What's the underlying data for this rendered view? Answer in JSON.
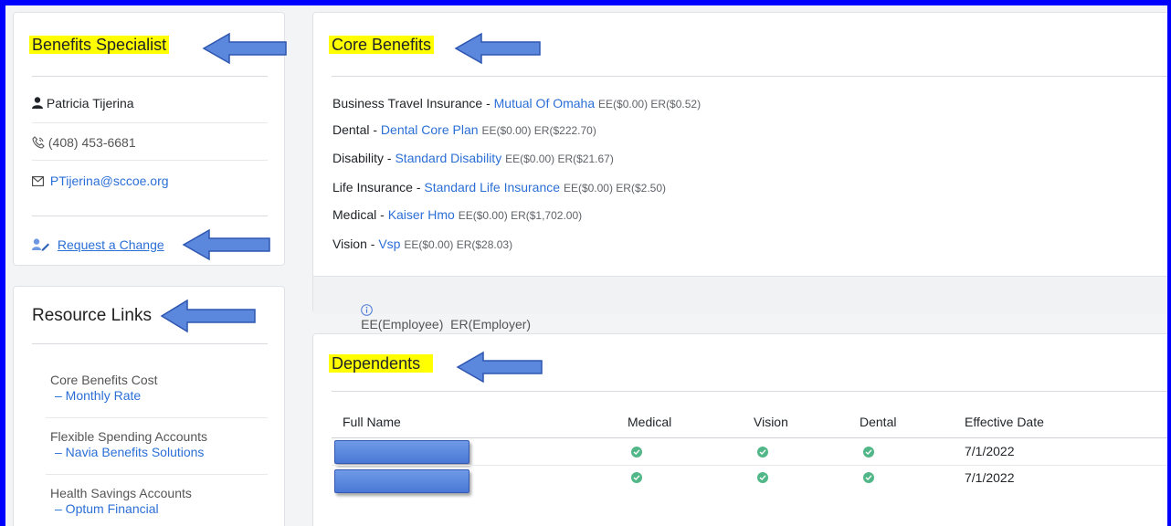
{
  "specialist": {
    "title": "Benefits Specialist",
    "name": "Patricia Tijerina",
    "phone": "(408) 453-6681",
    "email": "PTijerina@sccoe.org",
    "request_link": "Request a Change"
  },
  "resources": {
    "title": "Resource Links",
    "items": [
      {
        "label": "Core Benefits Cost",
        "link": "– Monthly Rate"
      },
      {
        "label": "Flexible Spending Accounts",
        "link": "– Navia Benefits Solutions"
      },
      {
        "label": "Health Savings Accounts",
        "link": "– Optum Financial"
      }
    ]
  },
  "core": {
    "title": "Core Benefits",
    "items": [
      {
        "category": "Business Travel Insurance -",
        "plan": "Mutual Of Omaha",
        "cost": "EE($0.00) ER($0.52)"
      },
      {
        "category": "Dental -",
        "plan": "Dental Core Plan",
        "cost": "EE($0.00) ER($222.70)"
      },
      {
        "category": "Disability -",
        "plan": "Standard Disability",
        "cost": "EE($0.00) ER($21.67)"
      },
      {
        "category": "Life Insurance -",
        "plan": "Standard Life Insurance",
        "cost": "EE($0.00) ER($2.50)"
      },
      {
        "category": "Medical -",
        "plan": "Kaiser Hmo",
        "cost": "EE($0.00) ER($1,702.00)"
      },
      {
        "category": "Vision -",
        "plan": "Vsp",
        "cost": "EE($0.00) ER($28.03)"
      }
    ],
    "footer": "EE(Employee)  ER(Employer)"
  },
  "dependents": {
    "title": "Dependents",
    "columns": [
      "Full Name",
      "Medical",
      "Vision",
      "Dental",
      "Effective Date"
    ],
    "rows": [
      {
        "medical": true,
        "vision": true,
        "dental": true,
        "effective": "7/1/2022"
      },
      {
        "medical": true,
        "vision": true,
        "dental": true,
        "effective": "7/1/2022"
      }
    ]
  },
  "colors": {
    "highlight": "#ffff00",
    "link": "#2b6fd6",
    "check": "#52b788",
    "frame": "#0000ff",
    "annotation_arrow": "#4a78d6"
  },
  "icons": [
    "person-icon",
    "phone-icon",
    "mail-icon",
    "edit-user-icon",
    "info-icon",
    "check-circle-icon",
    "arrow-left-icon"
  ]
}
